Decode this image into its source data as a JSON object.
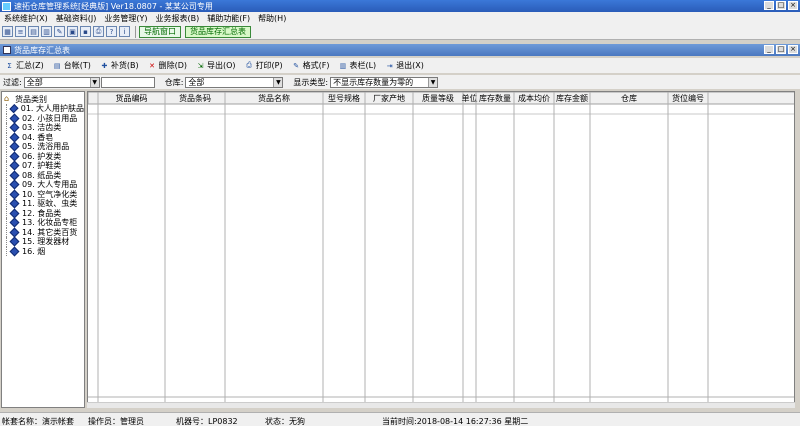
{
  "app": {
    "title": "速拓仓库管理系统[经典版] Ver18.0807 - 某某公司专用",
    "window_controls": [
      "_",
      "□",
      "×"
    ]
  },
  "menu": [
    "系统维护(X)",
    "基础资料(J)",
    "业务管理(Y)",
    "业务报表(B)",
    "辅助功能(F)",
    "帮助(H)"
  ],
  "quick_tabs": {
    "nav": "导航窗口",
    "report": "货品库存汇总表"
  },
  "child": {
    "title": "货品库存汇总表",
    "controls": [
      "_",
      "□",
      "×"
    ]
  },
  "toolbar": {
    "summary": "汇总(Z)",
    "ledger": "台帐(T)",
    "restock": "补货(B)",
    "delete": "删除(D)",
    "export": "导出(O)",
    "print": "打印(P)",
    "format": "格式(F)",
    "columns": "表栏(L)",
    "exit": "退出(X)"
  },
  "filter": {
    "filter_label": "过滤:",
    "filter_value": "全部",
    "warehouse_label": "仓库:",
    "warehouse_value": "全部",
    "display_label": "显示类型:",
    "display_value": "不显示库存数量为零的"
  },
  "tree": {
    "root": "货品类别",
    "items": [
      "01. 大人用护肤品",
      "02. 小孩日用品",
      "03. 洁齿类",
      "04. 香皂",
      "05. 洗浴用品",
      "06. 护发类",
      "07. 护鞋类",
      "08. 纸品类",
      "09. 大人专用品",
      "10. 空气净化类",
      "11. 驱蚊、虫类",
      "12. 食品类",
      "13. 化妆品专柜",
      "14. 其它类百货",
      "15. 理发器材",
      "16. 烟"
    ]
  },
  "table": {
    "columns": [
      "货品编码",
      "货品条码",
      "货品名称",
      "型号规格",
      "厂家产地",
      "质量等级",
      "单位",
      "库存数量",
      "成本均价",
      "库存金额",
      "仓库",
      "货位编号"
    ]
  },
  "status": {
    "account": "帐套名称：演示帐套",
    "operator": "操作员：管理员",
    "machine": "机器号：LP0832",
    "state": "状态：无狗",
    "time": "当前时间:2018-08-14 16:27:36 星期二"
  }
}
